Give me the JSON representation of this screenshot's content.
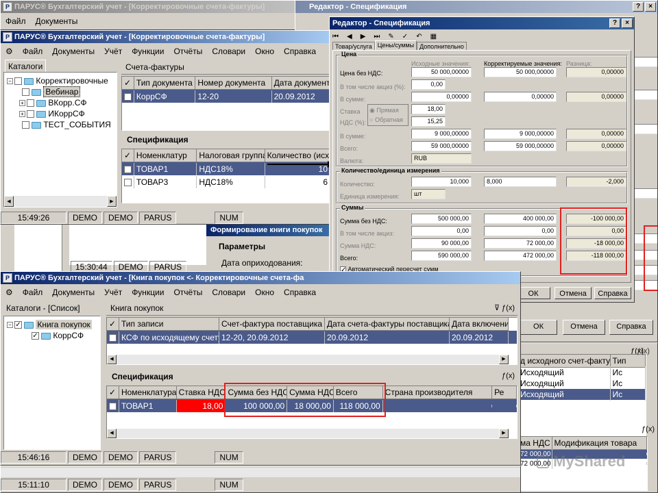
{
  "bg_window_1": {
    "title": "ПАРУС® Бухгалтерский учет - [Корректировочные счета-фактуры]",
    "menu": [
      "Файл",
      "Документы"
    ]
  },
  "editor_bg": {
    "title": "Редактор - Спецификация",
    "buttons": {
      "ok": "ОК",
      "cancel": "Отмена",
      "help": "Справка"
    }
  },
  "win1": {
    "title": "ПАРУС® Бухгалтерский учет - [Корректировочные счета-фактуры]",
    "menu": [
      "Файл",
      "Документы",
      "Учёт",
      "Функции",
      "Отчёты",
      "Словари",
      "Окно",
      "Справка"
    ],
    "catalogs_tab": "Каталоги",
    "tree": [
      "Корректировочные",
      "Вебинар",
      "ВКорр.СФ",
      "ИКоррСФ",
      "ТЕСТ_СОБЫТИЯ"
    ],
    "invoices_tab": "Счета-фактуры",
    "inv_cols": [
      "Тип документа",
      "Номер документа",
      "Дата документ"
    ],
    "inv_rows": [
      [
        "КоррСФ",
        "12-20",
        "20.09.2012"
      ]
    ],
    "spec_title": "Спецификация",
    "spec_cols": [
      "Номенклатур",
      "Налоговая группа",
      "Количество (исхо"
    ],
    "spec_rows": [
      [
        "ТОВАР1",
        "НДС18%",
        "10"
      ],
      [
        "ТОВАР3",
        "НДС18%",
        "6"
      ]
    ],
    "status": [
      "15:49:26",
      "DEMO",
      "DEMO",
      "PARUS",
      "NUM"
    ]
  },
  "mid": {
    "form_title": "Формирование книги покупок",
    "params": "Параметры",
    "date_label": "Дата оприходования:",
    "status": [
      "15:30:44",
      "DEMO",
      "PARUS"
    ]
  },
  "editor": {
    "title": "Редактор - Спецификация",
    "tabs": [
      "Товар/услуга",
      "Цены/суммы",
      "Дополнительно"
    ],
    "price_group": "Цена",
    "col_src": "Исходные значения:",
    "col_corr": "Корректируемые значения:",
    "col_diff": "Разница:",
    "labels": {
      "price_novat": "Цена без НДС:",
      "incl_excise": "В том числе акциз (%):",
      "in_sum": "В сумме:",
      "rate": "Ставка",
      "vat": "НДС (%):",
      "direct": "Прямая",
      "reverse": "Обратная",
      "in_sum2": "В сумме:",
      "total": "Всего:",
      "currency": "Валюта:"
    },
    "price_vals": {
      "price_src": "50 000,00000",
      "price_corr": "50 000,00000",
      "price_diff": "0,00000",
      "excise": "0,00",
      "sum_src": "0,00000",
      "sum_corr": "0,00000",
      "sum_diff": "0,00000",
      "rate": "18,00",
      "vat": "15,25",
      "vsum_src": "9 000,00000",
      "vsum_corr": "9 000,00000",
      "vsum_diff": "0,00000",
      "total_src": "59 000,00000",
      "total_corr": "59 000,00000",
      "total_diff": "0,00000",
      "currency": "RUB"
    },
    "qty_group": "Количество/единица измерения",
    "qty_label": "Количество:",
    "unit_label": "Единица измерения:",
    "qty_src": "10,000",
    "qty_corr": "8,000",
    "qty_diff": "-2,000",
    "unit": "шт",
    "sums_group": "Суммы",
    "sums_labels": [
      "Сумма без НДС:",
      "В том числе акциз:",
      "Сумма НДС:",
      "Всего:"
    ],
    "sums_src": [
      "500 000,00",
      "0,00",
      "90 000,00",
      "590 000,00"
    ],
    "sums_corr": [
      "400 000,00",
      "0,00",
      "72 000,00",
      "472 000,00"
    ],
    "sums_diff": [
      "-100 000,00",
      "0,00",
      "-18 000,00",
      "-118 000,00"
    ],
    "auto_recalc": "Автоматический пересчет сумм",
    "buttons": {
      "ok": "ОК",
      "cancel": "Отмена",
      "help": "Справка"
    }
  },
  "right_panel": {
    "col_src": "д исходного счет-фактуры",
    "col_type": "Тип",
    "rows": [
      "Исходящий",
      "Исходящий",
      "Исходящий"
    ],
    "type_cells": [
      "Ис",
      "Ис",
      "Ис"
    ],
    "col_vat": "ма НДС",
    "col_mod": "Модификация товара",
    "vat_rows": [
      "72 000,00",
      "72 000,00"
    ],
    "watermark": "MyShared"
  },
  "win2": {
    "title": "ПАРУС® Бухгалтерский учет - [Книга покупок <- Корректировочные счета-фа",
    "menu": [
      "Файл",
      "Документы",
      "Учёт",
      "Функции",
      "Отчёты",
      "Словари",
      "Окно",
      "Справка"
    ],
    "catalogs_tab": "Каталоги - [Список]",
    "tree": [
      "Книга покупок",
      "КоррСФ"
    ],
    "book_tab": "Книга покупок",
    "book_cols": [
      "Тип записи",
      "Счет-фактура поставщика",
      "Дата счета-фактуры поставщика",
      "Дата включени"
    ],
    "book_rows": [
      [
        "КСФ по исходящему счету",
        "12-20, 20.09.2012",
        "20.09.2012",
        "20.09.2012"
      ]
    ],
    "spec_title": "Спецификация",
    "spec_cols": [
      "Номенклатура",
      "Ставка НДС",
      "Сумма без НДС",
      "Сумма НДС",
      "Всего",
      "Страна производителя",
      "Ре"
    ],
    "spec_rows": [
      [
        "ТОВАР1",
        "18,00",
        "100 000,00",
        "18 000,00",
        "118 000,00",
        "",
        ""
      ]
    ],
    "status": [
      "15:46:16",
      "DEMO",
      "DEMO",
      "PARUS",
      "NUM"
    ]
  },
  "bottom_status": [
    "15:11:10",
    "DEMO",
    "DEMO",
    "PARUS",
    "NUM"
  ]
}
